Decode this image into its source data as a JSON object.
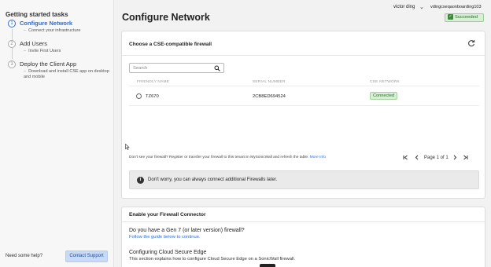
{
  "sidebar": {
    "title": "Getting started tasks",
    "steps": [
      {
        "num": "1",
        "title": "Configure Network",
        "subs": [
          "Connect your infrastructure"
        ]
      },
      {
        "num": "2",
        "title": "Add Users",
        "subs": [
          "Invite First Users"
        ]
      },
      {
        "num": "3",
        "title": "Deploy the Client App",
        "subs": [
          "Download and install CSE app on desktop and mobile"
        ]
      }
    ],
    "help_text": "Need some help?",
    "support_button": "Contact Support"
  },
  "header": {
    "title": "Configure Network",
    "user_name": "victor ding",
    "tenant": "vdingcseqaonboarding103",
    "status": "Succeeded"
  },
  "firewall_card": {
    "title": "Choose a CSE-compatible firewall",
    "search_placeholder": "Search",
    "columns": [
      "FRIENDLY NAME",
      "SERIAL NUMBER",
      "CSE NETWORK"
    ],
    "rows": [
      {
        "name": "TZ670",
        "serial": "2CB8ED694524",
        "status": "Connected"
      }
    ],
    "footer_text": "Don't see your firewall? Register or transfer your firewall to this tenant in MySonicWall and refresh the table.",
    "footer_link": "More Info",
    "pagination": "Page 1 of 1",
    "info_text": "Don't worry, you can always connect additional Firewalls later."
  },
  "connector_card": {
    "title": "Enable your Firewall Connector",
    "question": "Do you have a Gen 7 (or later version) firewall?",
    "guide_link": "Follow the guide below to continue.",
    "section_title": "Configuring Cloud Secure Edge",
    "section_desc": "This section explains how to configure Cloud Secure Edge on a SonicWall firewall."
  },
  "colors": {
    "accent": "#2d6bcf",
    "success_bg": "#d8eed6",
    "success_text": "#2b6e2b",
    "support_btn_bg": "#c9daf6"
  },
  "icons": [
    "refresh-icon",
    "search-icon",
    "info-icon",
    "chevron-down-icon",
    "first-page-icon",
    "prev-page-icon",
    "next-page-icon",
    "last-page-icon",
    "check-icon"
  ]
}
